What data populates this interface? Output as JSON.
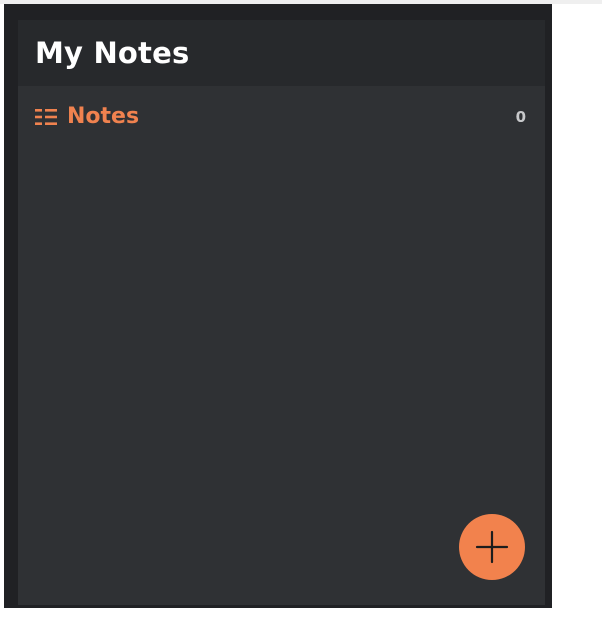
{
  "header": {
    "title": "My Notes"
  },
  "sidebar": {
    "items": [
      {
        "label": "Notes",
        "count": "0",
        "icon": "list-icon"
      }
    ]
  },
  "fab": {
    "icon": "plus-icon"
  },
  "colors": {
    "accent": "#f2824d",
    "panel": "#2f3134",
    "header": "#27292c",
    "frame": "#202124",
    "title_text": "#ffffff",
    "count_text": "#c7c8ca"
  }
}
